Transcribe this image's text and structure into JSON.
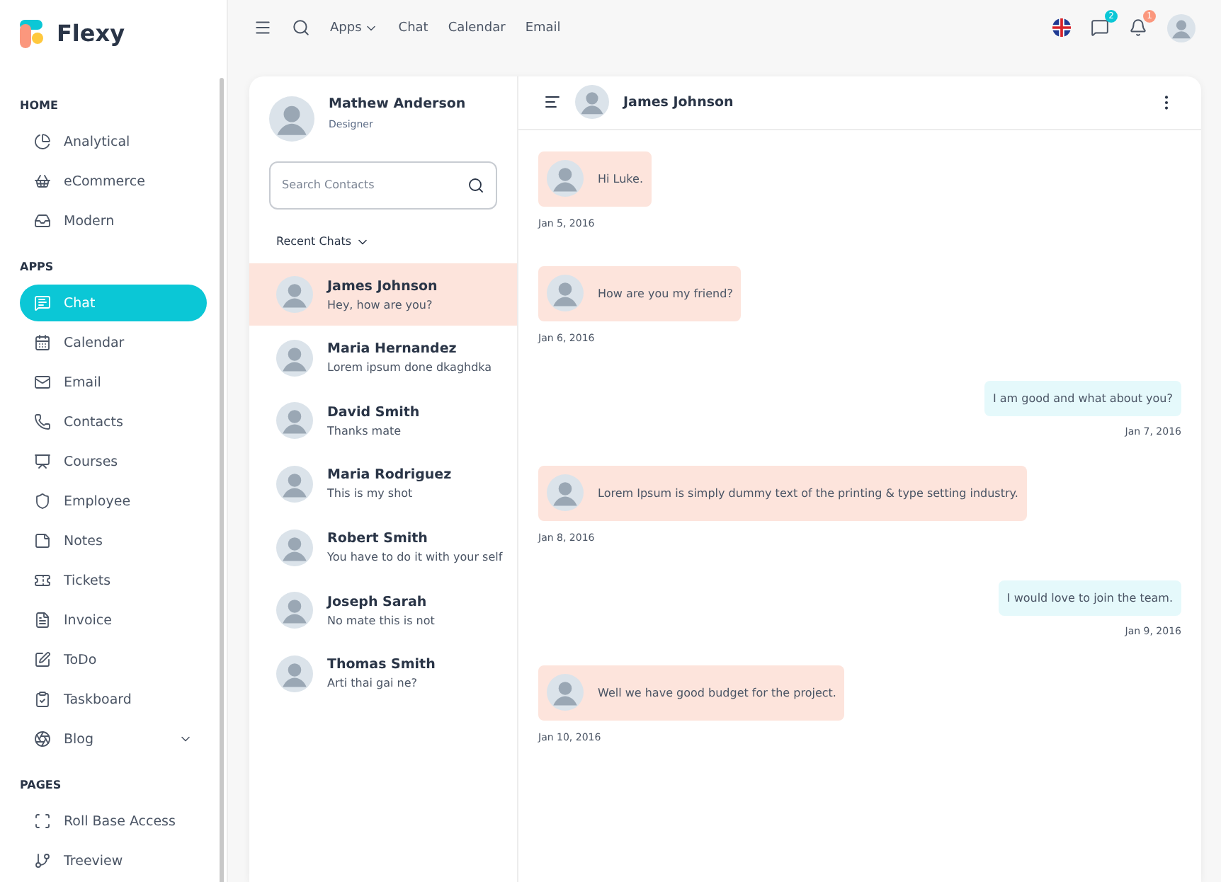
{
  "brand": {
    "name": "Flexy"
  },
  "sidebar": {
    "sections": [
      {
        "heading": "HOME",
        "items": [
          {
            "label": "Analytical",
            "selected": false
          },
          {
            "label": "eCommerce",
            "selected": false
          },
          {
            "label": "Modern",
            "selected": false
          }
        ]
      },
      {
        "heading": "APPS",
        "items": [
          {
            "label": "Chat",
            "selected": true
          },
          {
            "label": "Calendar",
            "selected": false
          },
          {
            "label": "Email",
            "selected": false
          },
          {
            "label": "Contacts",
            "selected": false
          },
          {
            "label": "Courses",
            "selected": false
          },
          {
            "label": "Employee",
            "selected": false
          },
          {
            "label": "Notes",
            "selected": false
          },
          {
            "label": "Tickets",
            "selected": false
          },
          {
            "label": "Invoice",
            "selected": false
          },
          {
            "label": "ToDo",
            "selected": false
          },
          {
            "label": "Taskboard",
            "selected": false
          },
          {
            "label": "Blog",
            "selected": false,
            "expandable": true
          }
        ]
      },
      {
        "heading": "PAGES",
        "items": [
          {
            "label": "Roll Base Access",
            "selected": false
          },
          {
            "label": "Treeview",
            "selected": false
          }
        ]
      }
    ]
  },
  "topbar": {
    "links": [
      {
        "label": "Apps",
        "dropdown": true
      },
      {
        "label": "Chat",
        "dropdown": false
      },
      {
        "label": "Calendar",
        "dropdown": false
      },
      {
        "label": "Email",
        "dropdown": false
      }
    ],
    "message_count": "2",
    "notification_count": "1"
  },
  "chat": {
    "user": {
      "name": "Mathew Anderson",
      "role": "Designer"
    },
    "search": {
      "placeholder": "Search Contacts"
    },
    "recent_label": "Recent Chats",
    "contacts": [
      {
        "name": "James Johnson",
        "message": "Hey, how are you?",
        "selected": true
      },
      {
        "name": "Maria Hernandez",
        "message": "Lorem ipsum done dkaghdka",
        "selected": false
      },
      {
        "name": "David Smith",
        "message": "Thanks mate",
        "selected": false
      },
      {
        "name": "Maria Rodriguez",
        "message": "This is my shot",
        "selected": false
      },
      {
        "name": "Robert Smith",
        "message": "You have to do it with your self",
        "selected": false
      },
      {
        "name": "Joseph Sarah",
        "message": "No mate this is not",
        "selected": false
      },
      {
        "name": "Thomas Smith",
        "message": "Arti thai gai ne?",
        "selected": false
      }
    ],
    "conversation": {
      "name": "James Johnson",
      "messages": [
        {
          "kind": "received",
          "text": "Hi Luke.",
          "date": "Jan 5, 2016"
        },
        {
          "kind": "received",
          "text": "How are you my friend?",
          "date": "Jan 6, 2016"
        },
        {
          "kind": "sent",
          "text": "I am good and what about you?",
          "date": "Jan 7, 2016"
        },
        {
          "kind": "received",
          "text": "Lorem Ipsum is simply dummy text of the printing & type setting industry.",
          "date": "Jan 8, 2016"
        },
        {
          "kind": "sent",
          "text": "I would love to join the team.",
          "date": "Jan 9, 2016"
        },
        {
          "kind": "received",
          "text": "Well we have good budget for the project.",
          "date": "Jan 10, 2016"
        }
      ]
    }
  }
}
